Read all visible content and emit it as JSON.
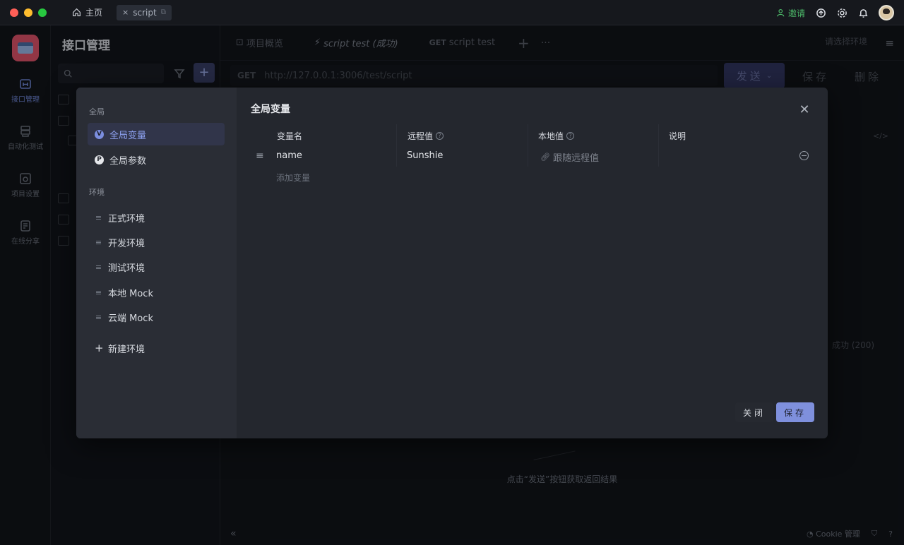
{
  "titlebar": {
    "home_label": "主页",
    "script_tab_label": "script",
    "invite_label": "邀请"
  },
  "rail": {
    "items": [
      {
        "label": "接口管理",
        "icon": "api-icon"
      },
      {
        "label": "自动化测试",
        "icon": "database-icon"
      },
      {
        "label": "项目设置",
        "icon": "settings-icon"
      },
      {
        "label": "在线分享",
        "icon": "share-doc-icon"
      }
    ]
  },
  "sidebar": {
    "title": "接口管理",
    "add_label": "+"
  },
  "main": {
    "tabs": [
      {
        "label": "项目概览"
      },
      {
        "label": "script test (成功)"
      },
      {
        "method": "GET",
        "label": "script test"
      }
    ],
    "env_select_label": "请选择环境",
    "method": "GET",
    "url": "http://127.0.0.1:3006/test/script",
    "send_label": "发送",
    "save_label": "保存",
    "delete_label": "删除",
    "status_label": "成功 (200)",
    "empty_hint": "点击“发送”按钮获取返回结果",
    "cookie_label": "Cookie 管理"
  },
  "modal": {
    "global_section_label": "全局",
    "global_items": [
      {
        "label": "全局变量",
        "active": true
      },
      {
        "label": "全局参数",
        "active": false
      }
    ],
    "env_section_label": "环境",
    "environments": [
      "正式环境",
      "开发环境",
      "测试环境",
      "本地 Mock",
      "云端 Mock"
    ],
    "new_env_label": "新建环境",
    "title": "全局变量",
    "columns": {
      "name": "变量名",
      "remote": "远程值",
      "local": "本地值",
      "desc": "说明"
    },
    "rows": [
      {
        "name": "name",
        "remote": "Sunshie",
        "local": "跟随远程值",
        "desc": ""
      }
    ],
    "add_variable_label": "添加变量",
    "close_label": "关闭",
    "save_label": "保存"
  },
  "colors": {
    "accent": "#7f90dd",
    "background": "#0f1217",
    "modal_bg": "#24272e",
    "modal_sidebar_bg": "#2a2d35",
    "invite_green": "#4dbb6a"
  }
}
